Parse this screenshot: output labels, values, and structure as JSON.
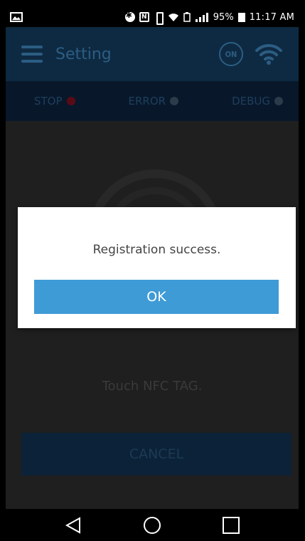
{
  "status_bar": {
    "battery_percent": "95%",
    "time": "11:17 AM"
  },
  "app_bar": {
    "title": "Setting",
    "on_badge": "ON"
  },
  "indicators": [
    {
      "label": "STOP",
      "color": "#c0102a"
    },
    {
      "label": "ERROR",
      "color": "#e6e6e6"
    },
    {
      "label": "DEBUG",
      "color": "#e6e6e6"
    }
  ],
  "content": {
    "hint": "Touch NFC TAG.",
    "cancel_label": "CANCEL"
  },
  "dialog": {
    "message": "Registration success.",
    "ok_label": "OK"
  },
  "colors": {
    "accent": "#3f9bd6",
    "app_bar": "#0e2a42"
  }
}
